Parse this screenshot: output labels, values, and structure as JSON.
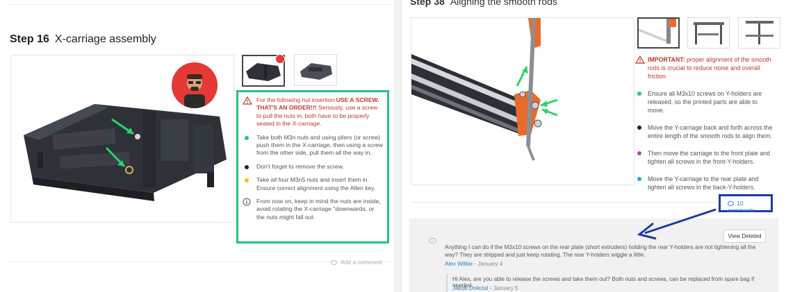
{
  "left": {
    "step_label": "Step 16",
    "step_name": "X-carriage assembly",
    "notes": [
      {
        "type": "warn",
        "icon": "warning-icon",
        "text_pre": "For the following nut insertion ",
        "text_bold": "USE A SCREW. THAT'S AN ORDER!!!",
        "text_post": " Seriously, use a screw to pull the nuts in, both have to be properly seated in the X-carriage."
      },
      {
        "type": "bullet",
        "color": "#27c281",
        "text": "Take both M3n nuts and using pliers (or screw) push them in the X-carriage, then using a screw from the other side, pull them all the way in."
      },
      {
        "type": "bullet",
        "color": "#222222",
        "text": "Don't forget to remove the screw."
      },
      {
        "type": "bullet",
        "color": "#f2c200",
        "text": "Take all four M3n5 nuts and insert them in. Ensure correct alignment using the Allen key."
      },
      {
        "type": "info",
        "icon": "info-icon",
        "text": "From now on, keep in mind the nuts are inside, avoid rotating the X-carriage \"downwards, or the nuts might fall out."
      }
    ],
    "add_comment": "Add a comment"
  },
  "right": {
    "step_label": "Step 38",
    "step_name": "Aligning the smooth rods",
    "notes": [
      {
        "type": "warn",
        "text_bold": "IMPORTANT:",
        "text_post": " proper alignment of the smooth rods is crucial to reduce noise and overall friction."
      },
      {
        "type": "bullet",
        "color": "#27c281",
        "text": "Ensure all M3x10 screws on Y-holders are released, so the printed parts are able to move."
      },
      {
        "type": "bullet",
        "color": "#222222",
        "text": "Move the Y-carriage back and forth across the entire length of the smooth rods to align them."
      },
      {
        "type": "bullet",
        "color": "#b04aa8",
        "text": "Then move the carriage to the front plate and tighten all screws in the front-Y-holders."
      },
      {
        "type": "bullet",
        "color": "#2aa4c9",
        "text": "Move the Y-carriage to the rear plate and tighten all screws in the back-Y-holders."
      }
    ],
    "comments_link": "10 comments",
    "view_deleted": "View Deleted",
    "comment": {
      "text": "Anything I can do if the M3x10 screws on the rear plate (short extruders) holding the rear Y-holders are not tightening all the way? They are stripped and just keep rotating. The rear Y-holders wiggle a little.",
      "author": "Alex Wilkie",
      "date": " - January 4"
    },
    "reply": {
      "text": "Hi Alex, are you able to release the screws and take them out? Both nuts and screws, can be replaced from spare bag if needed.",
      "author": "Jakub Dolezal",
      "date": " - January 5"
    }
  },
  "colors": {
    "highlight_green": "#27c281",
    "highlight_blue": "#1e3aa8",
    "warning_red": "#c0392b",
    "link_blue": "#2f7fc1"
  }
}
